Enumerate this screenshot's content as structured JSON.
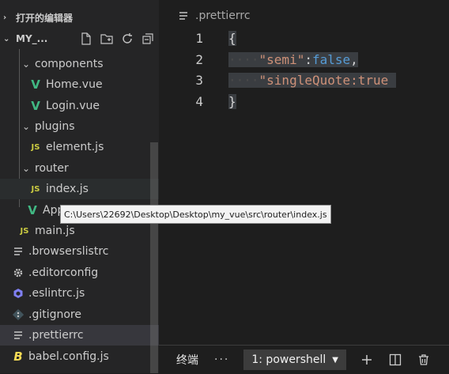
{
  "sidebar": {
    "open_editors_label": "打开的编辑器",
    "project_label": "MY_...",
    "tree": [
      {
        "label": "components",
        "icon": "folder-open",
        "kind": "folder"
      },
      {
        "label": "Home.vue",
        "icon": "vue-icon",
        "kind": "file"
      },
      {
        "label": "Login.vue",
        "icon": "vue-icon",
        "kind": "file"
      },
      {
        "label": "plugins",
        "icon": "folder-open",
        "kind": "folder"
      },
      {
        "label": "element.js",
        "icon": "js-icon",
        "kind": "file"
      },
      {
        "label": "router",
        "icon": "folder-open",
        "kind": "folder"
      },
      {
        "label": "index.js",
        "icon": "js-icon",
        "kind": "file"
      },
      {
        "label": "App",
        "icon": "vue-icon",
        "kind": "file"
      },
      {
        "label": "main.js",
        "icon": "js-icon",
        "kind": "file"
      },
      {
        "label": ".browserslistrc",
        "icon": "lines-icon",
        "kind": "file"
      },
      {
        "label": ".editorconfig",
        "icon": "gear-icon",
        "kind": "file"
      },
      {
        "label": ".eslintrc.js",
        "icon": "eslint-icon",
        "kind": "file"
      },
      {
        "label": ".gitignore",
        "icon": "git-icon",
        "kind": "file"
      },
      {
        "label": ".prettierrc",
        "icon": "lines-icon",
        "kind": "file"
      },
      {
        "label": "babel.config.js",
        "icon": "babel-icon",
        "kind": "file"
      }
    ],
    "tooltip": "C:\\Users\\22692\\Desktop\\Desktop\\my_vue\\src\\router\\index.js"
  },
  "editor": {
    "breadcrumb": ".prettierrc",
    "line_numbers": [
      "1",
      "2",
      "3",
      "4"
    ],
    "lines": {
      "l1": "{",
      "l2_key": "\"semi\"",
      "l2_sep": ":",
      "l2_val": "false",
      "l2_end": ",",
      "l3_text": "\"singleQuote:true",
      "l4": "}"
    },
    "indent_dots": "····"
  },
  "panel": {
    "tab_label": "终端",
    "more": "···",
    "terminal_select": "1: powershell"
  }
}
